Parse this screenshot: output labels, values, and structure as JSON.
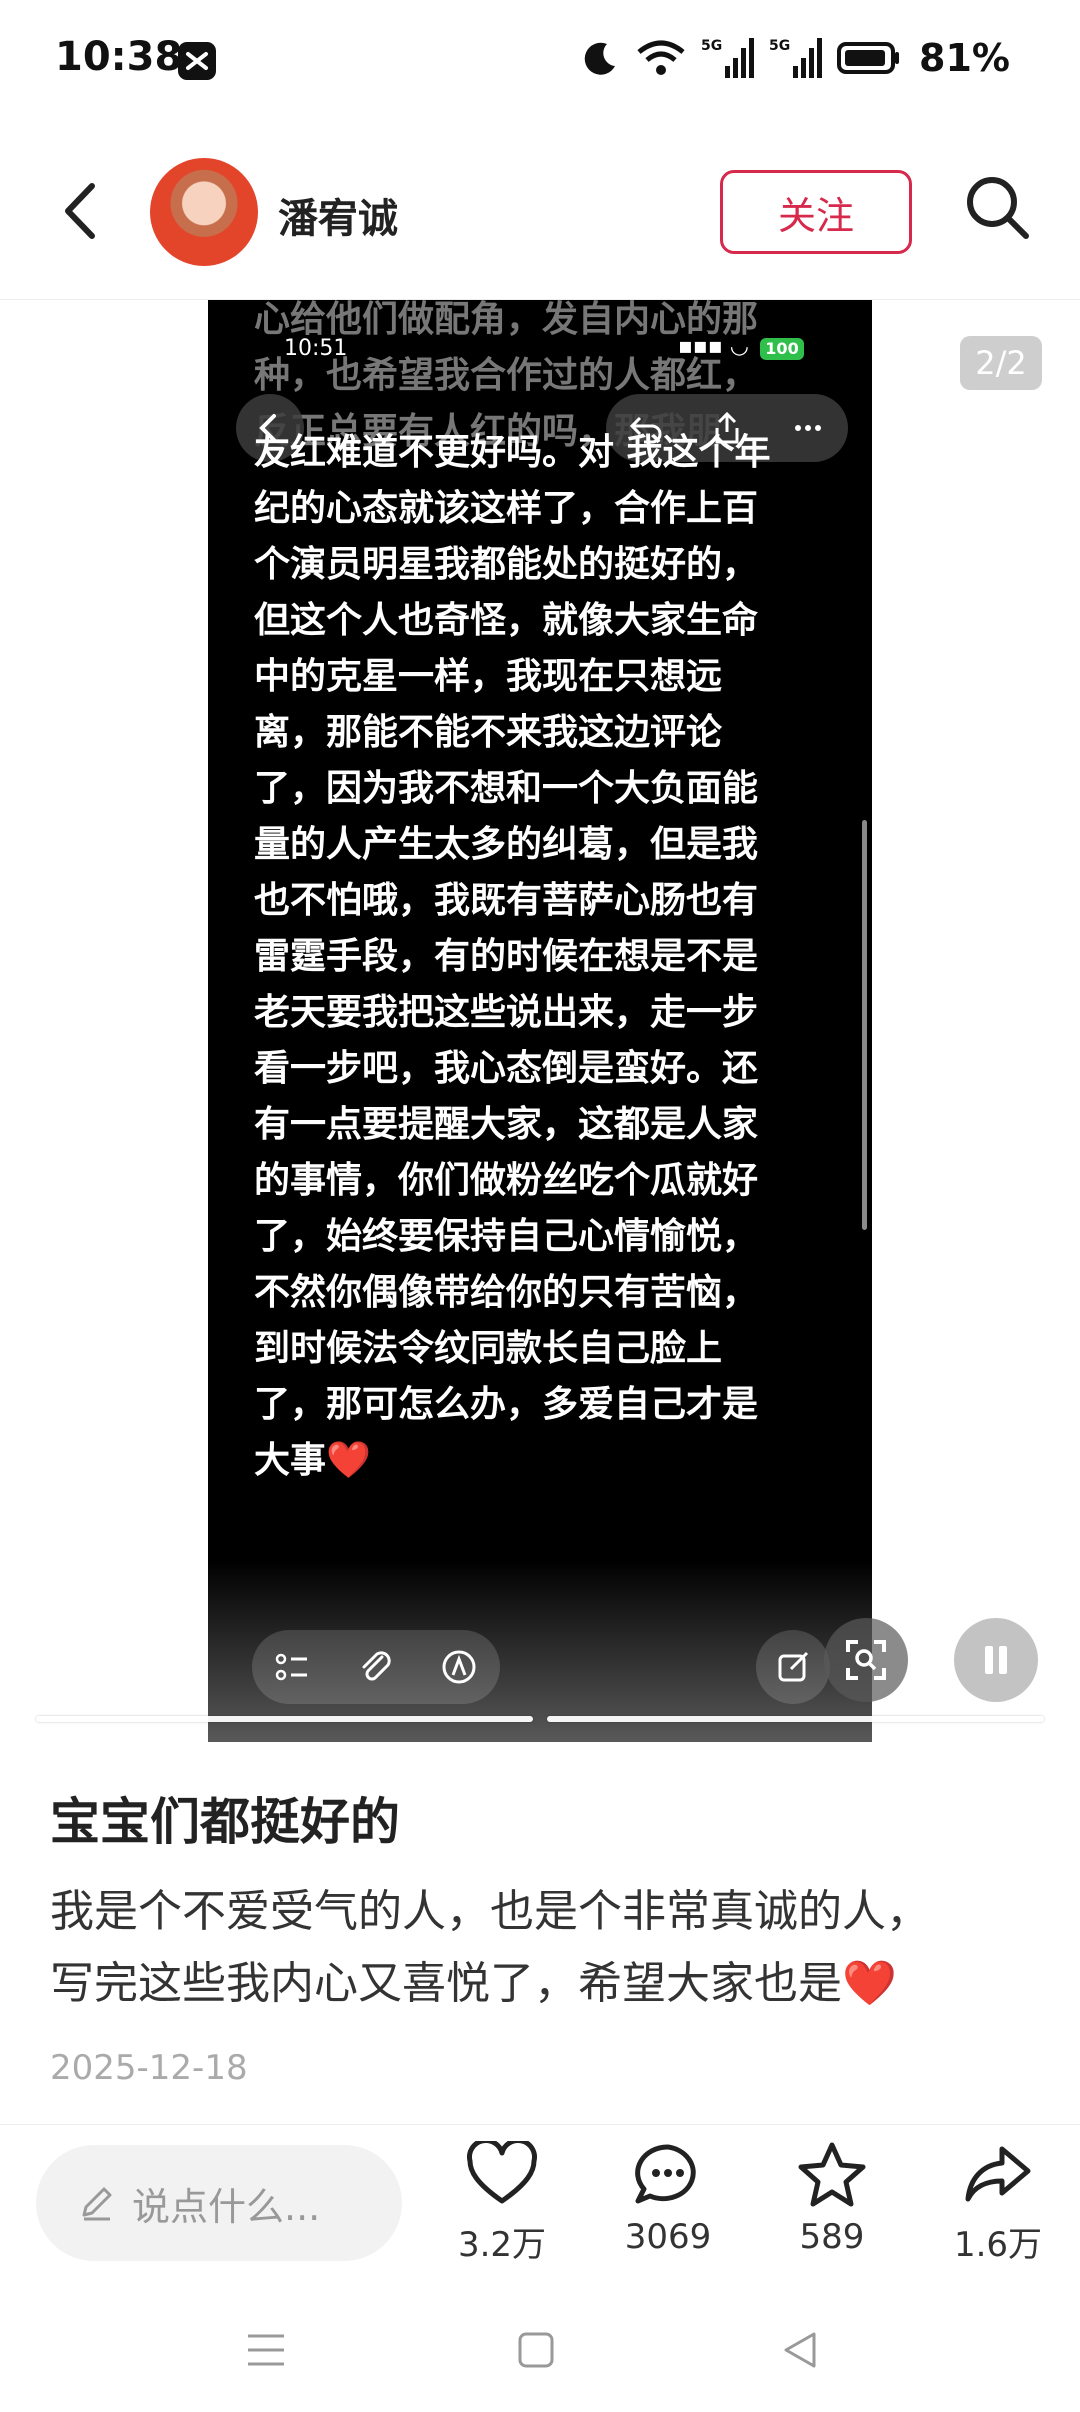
{
  "status_bar": {
    "time": "10:38",
    "battery": "81%",
    "signal_label": "5G"
  },
  "header": {
    "author_name": "潘宥诚",
    "follow_label": "关注"
  },
  "media": {
    "page_indicator": "2/2",
    "inner_status_time": "10:51",
    "inner_battery": "100",
    "note_top_faded": "心给他们做配角，发自内心的那\n种，也希望我合作过的人都红，\n反正总要有人红的吗，那我朋",
    "note_text": "友红难道不更好吗。对 我这个年\n纪的心态就该这样了，合作上百\n个演员明星我都能处的挺好的，\n但这个人也奇怪，就像大家生命\n中的克星一样，我现在只想远\n离，那能不能不来我这边评论\n了，因为我不想和一个大负面能\n量的人产生太多的纠葛，但是我\n也不怕哦，我既有菩萨心肠也有\n雷霆手段，有的时候在想是不是\n老天要我把这些说出来，走一步\n看一步吧，我心态倒是蛮好。还\n有一点要提醒大家，这都是人家\n的事情，你们做粉丝吃个瓜就好\n了，始终要保持自己心情愉悦，\n不然你偶像带给你的只有苦恼，\n到时候法令纹同款长自己脸上\n了，那可怎么办，多爱自己才是\n大事❤️",
    "progress_segments": 2,
    "current_segment": 2
  },
  "post": {
    "title": "宝宝们都挺好的",
    "body": "我是个不爱受气的人，也是个非常真诚的人，\n写完这些我内心又喜悦了，希望大家也是❤️",
    "date": "2025-12-18"
  },
  "action_bar": {
    "comment_placeholder": "说点什么...",
    "likes": "3.2万",
    "comments": "3069",
    "favorites": "589",
    "shares": "1.6万"
  },
  "colors": {
    "accent": "#d6294b",
    "battery_green": "#2fbf4b"
  }
}
